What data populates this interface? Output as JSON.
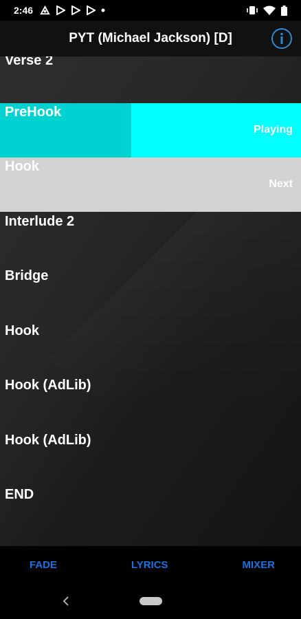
{
  "status_bar": {
    "time": "2:46",
    "notifications": [
      "cloud-sync-icon",
      "play-store-icon",
      "play-store-icon",
      "play-store-icon",
      "dot-icon"
    ],
    "system_icons": [
      "vibrate-icon",
      "wifi-icon",
      "battery-icon"
    ]
  },
  "header": {
    "title": "PYT (Michael Jackson) [D]",
    "info_icon": "info-icon"
  },
  "sections": [
    {
      "label": "Verse 2",
      "state": "",
      "status_text": ""
    },
    {
      "label": "PreHook",
      "state": "playing",
      "status_text": "Playing",
      "progress": 0.436
    },
    {
      "label": "Hook",
      "state": "next",
      "status_text": "Next"
    },
    {
      "label": "Interlude 2",
      "state": "",
      "status_text": ""
    },
    {
      "label": "Bridge",
      "state": "",
      "status_text": ""
    },
    {
      "label": "Hook",
      "state": "",
      "status_text": ""
    },
    {
      "label": "Hook (AdLib)",
      "state": "",
      "status_text": ""
    },
    {
      "label": "Hook (AdLib)",
      "state": "",
      "status_text": ""
    },
    {
      "label": "END",
      "state": "",
      "status_text": ""
    }
  ],
  "bottom_bar": {
    "fade": "FADE",
    "lyrics": "LYRICS",
    "mixer": "MIXER"
  },
  "colors": {
    "playing": "#00ffff",
    "playing_progress": "#00d1d1",
    "next": "#d2d2d2",
    "accent_button": "#1f6fe0",
    "info_icon": "#2a8bd8"
  }
}
